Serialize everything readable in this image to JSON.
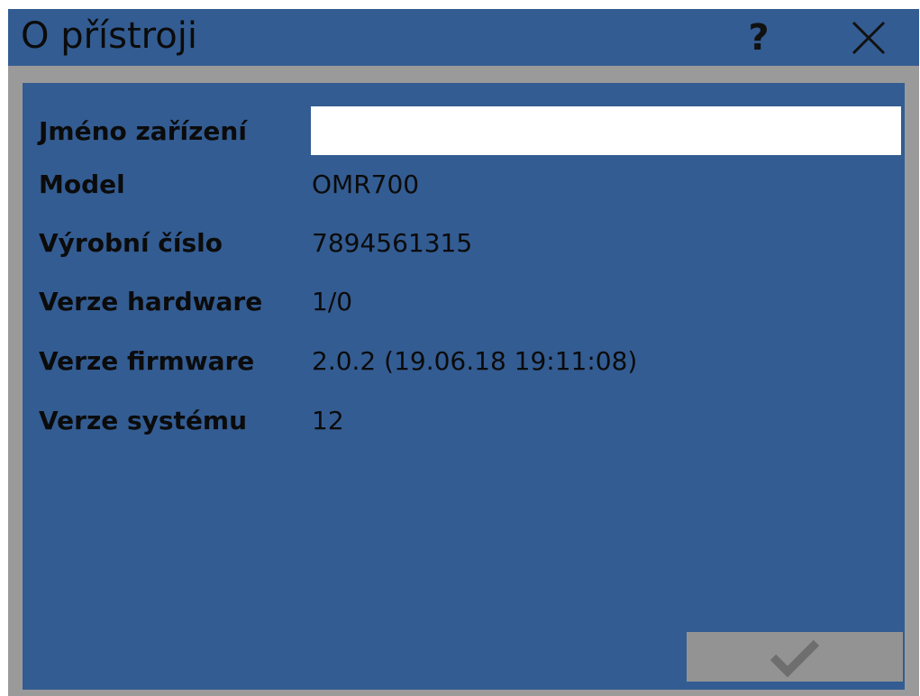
{
  "window": {
    "title": "O přístroji",
    "help_icon": "question-icon",
    "close_icon": "close-icon"
  },
  "device_info": {
    "name": {
      "label": "Jméno zařízení",
      "value": "",
      "placeholder": ""
    },
    "model": {
      "label": "Model",
      "value": "OMR700"
    },
    "serial": {
      "label": "Výrobní číslo",
      "value": "7894561315"
    },
    "hardware": {
      "label": "Verze hardware",
      "value": "1/0"
    },
    "firmware": {
      "label": "Verze firmware",
      "value": "2.0.2 (19.06.18 19:11:08)"
    },
    "system": {
      "label": "Verze systému",
      "value": "12"
    }
  },
  "actions": {
    "confirm_icon": "checkmark-icon",
    "confirm_enabled": false
  },
  "colors": {
    "background": "#335c92",
    "frame": "#9a9a9a",
    "input": "#ffffff",
    "disabled_button": "#939393",
    "disabled_icon": "#6e6e6e"
  }
}
